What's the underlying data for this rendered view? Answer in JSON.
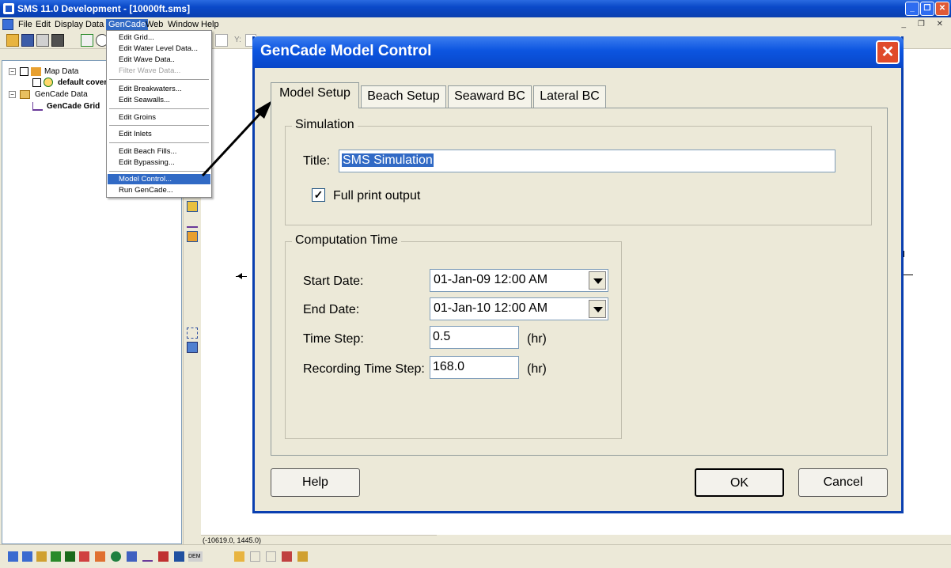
{
  "app": {
    "title": "SMS 11.0 Development - [10000ft.sms]",
    "menu": [
      "File",
      "Edit",
      "Display",
      "Data",
      "GenCade",
      "Web",
      "Window",
      "Help"
    ],
    "active_menu": "GenCade",
    "toolbar_label_y": "Y:"
  },
  "explorer": {
    "items": [
      {
        "label": "Map Data"
      },
      {
        "label": "default cover"
      },
      {
        "label": "GenCade Data"
      },
      {
        "label": "GenCade Grid"
      }
    ]
  },
  "gencade_menu": {
    "items": [
      {
        "label": "Edit Grid...",
        "state": "normal"
      },
      {
        "label": "Edit Water Level Data...",
        "state": "normal"
      },
      {
        "label": "Edit Wave Data..",
        "state": "normal"
      },
      {
        "label": "Filter Wave Data...",
        "state": "disabled"
      },
      {
        "label": "Edit Breakwaters...",
        "state": "normal"
      },
      {
        "label": "Edit Seawalls...",
        "state": "normal"
      },
      {
        "label": "Edit Groins",
        "state": "normal"
      },
      {
        "label": "Edit Inlets",
        "state": "normal"
      },
      {
        "label": "Edit Beach Fills...",
        "state": "normal"
      },
      {
        "label": "Edit Bypassing...",
        "state": "normal"
      },
      {
        "label": "Model Control...",
        "state": "highlighted"
      },
      {
        "label": "Run GenCade...",
        "state": "normal"
      }
    ]
  },
  "dialog": {
    "title": "GenCade Model Control",
    "close_label": "✕",
    "tabs": [
      {
        "label": "Model Setup",
        "selected": true
      },
      {
        "label": "Beach Setup",
        "selected": false
      },
      {
        "label": "Seaward BC",
        "selected": false
      },
      {
        "label": "Lateral BC",
        "selected": false
      }
    ],
    "simulation": {
      "group_label": "Simulation",
      "title_label": "Title:",
      "title_value": "SMS Simulation",
      "full_print_label": "Full print output",
      "full_print_checked": true
    },
    "computation": {
      "group_label": "Computation Time",
      "start_label": "Start Date:",
      "start_value": "01-Jan-09 12:00 AM",
      "end_label": "End Date:",
      "end_value": "01-Jan-10 12:00 AM",
      "step_label": "Time Step:",
      "step_value": "0.5",
      "step_unit": "(hr)",
      "rec_label": "Recording Time Step:",
      "rec_value": "168.0",
      "rec_unit": "(hr)"
    },
    "buttons": {
      "help": "Help",
      "ok": "OK",
      "cancel": "Cancel"
    }
  },
  "status": {
    "coords": "(-10619.0, 1445.0)"
  },
  "colors": {
    "titlebar": "#0a49c8",
    "highlight": "#316ac5",
    "close": "#e04b2a"
  }
}
